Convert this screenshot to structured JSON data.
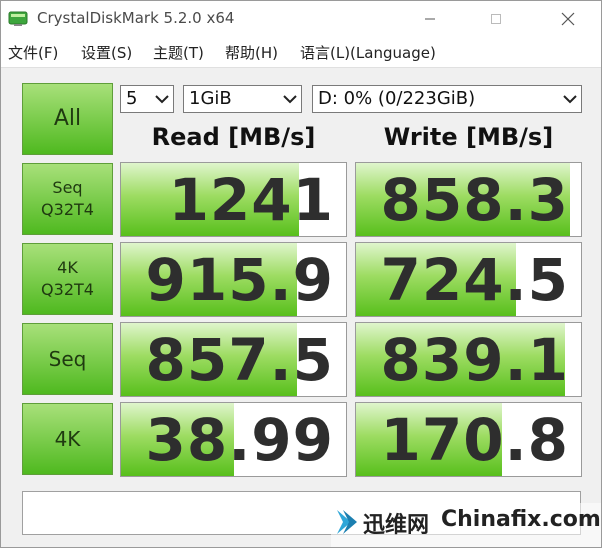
{
  "window": {
    "title": "CrystalDiskMark 5.2.0 x64",
    "icon": "crystaldiskmark-app-icon"
  },
  "menu": {
    "items": [
      "文件(F)",
      "设置(S)",
      "主题(T)",
      "帮助(H)",
      "语言(L)(Language)"
    ]
  },
  "controls": {
    "all_label": "All",
    "runs": "5",
    "size": "1GiB",
    "drive": "D: 0% (0/223GiB)"
  },
  "columns": {
    "read": "Read [MB/s]",
    "write": "Write [MB/s]"
  },
  "tests": [
    {
      "label_1": "Seq",
      "label_2": "Q32T4",
      "read": "1241",
      "write": "858.3",
      "read_fill": 0.79,
      "write_fill": 0.95
    },
    {
      "label_1": "4K",
      "label_2": "Q32T4",
      "read": "915.9",
      "write": "724.5",
      "read_fill": 0.78,
      "write_fill": 0.71
    },
    {
      "label_1": "Seq",
      "label_2": "",
      "read": "857.5",
      "write": "839.1",
      "read_fill": 0.78,
      "write_fill": 0.93
    },
    {
      "label_1": "4K",
      "label_2": "",
      "read": "38.99",
      "write": "170.8",
      "read_fill": 0.5,
      "write_fill": 0.65
    }
  ],
  "status_text": "",
  "watermark": {
    "cn": "迅维网",
    "en": "Chinafix.com"
  },
  "colors": {
    "accent_green": "#4fb91f",
    "bar_light": "#dff5cc"
  }
}
